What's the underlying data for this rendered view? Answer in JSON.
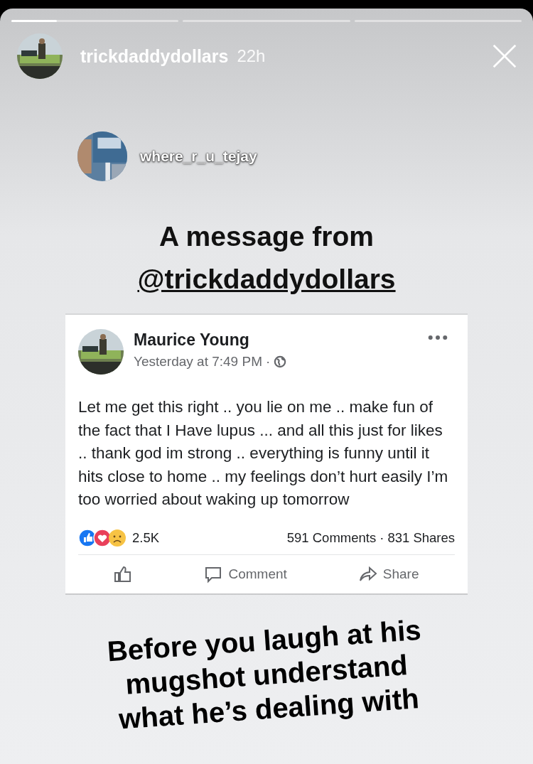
{
  "progress": [
    {
      "kind": "current",
      "level": 0.27
    },
    {
      "kind": "upcoming"
    },
    {
      "kind": "upcoming"
    }
  ],
  "header": {
    "username": "trickdaddydollars",
    "time": "22h"
  },
  "repost": {
    "username": "where_r_u_tejay"
  },
  "title": {
    "text": "A message from",
    "mention": "@trickdaddydollars"
  },
  "post": {
    "author": "Maurice Young",
    "time": "Yesterday at 7:49 PM",
    "separator": "·",
    "body": "Let me get this right .. you lie on me .. make fun of the fact that I Have lupus ... and all this just for likes .. thank god im strong ..  everything is funny until it hits close to home .. my feelings don’t hurt easily I’m too worried about waking up tomorrow",
    "reactions": "2.5K",
    "comments": "591 Comments",
    "stats_separator": "·",
    "shares": "831 Shares",
    "actions": [
      {
        "kind": "like"
      },
      {
        "kind": "comment",
        "label": "Comment"
      },
      {
        "kind": "share",
        "label": "Share"
      }
    ]
  },
  "caption": "Before you laugh at his mugshot understand what he’s dealing with"
}
